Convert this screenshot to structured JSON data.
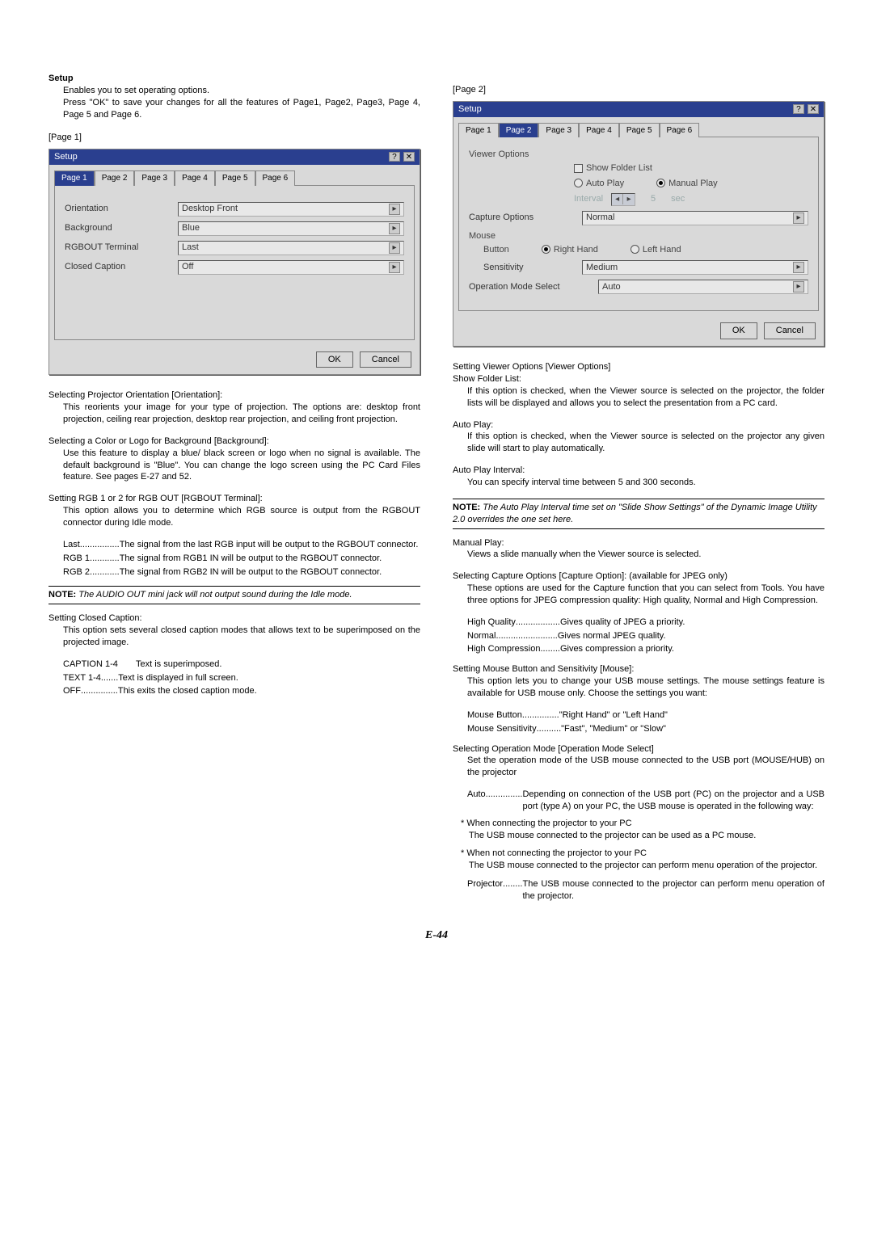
{
  "pageNumber": "E-44",
  "left": {
    "setup": {
      "heading": "Setup",
      "l1": "Enables you to set operating options.",
      "l2": "Press \"OK\" to save your changes for all the features of Page1, Page2, Page3, Page 4, Page 5 and Page 6."
    },
    "page1Label": "[Page 1]",
    "dialog1": {
      "title": "Setup",
      "help": "?",
      "close": "✕",
      "tabs": [
        "Page 1",
        "Page 2",
        "Page 3",
        "Page 4",
        "Page 5",
        "Page 6"
      ],
      "rows": {
        "orientation": {
          "label": "Orientation",
          "value": "Desktop Front"
        },
        "background": {
          "label": "Background",
          "value": "Blue"
        },
        "rgbout": {
          "label": "RGBOUT Terminal",
          "value": "Last"
        },
        "cc": {
          "label": "Closed Caption",
          "value": "Off"
        }
      },
      "ok": "OK",
      "cancel": "Cancel"
    },
    "orient": {
      "h": "Selecting Projector Orientation [Orientation]:",
      "p": "This reorients your image for your type of projection. The options are: desktop front projection, ceiling rear projection, desktop rear projection, and ceiling front projection."
    },
    "bg": {
      "h": "Selecting a Color or Logo for Background [Background]:",
      "p": "Use this feature to display a blue/ black screen or logo when no signal is available. The default background is \"Blue\". You can change the logo screen using the PC Card Files feature. See pages E-27 and 52."
    },
    "rgb": {
      "h": "Setting RGB 1 or 2 for RGB OUT [RGBOUT Terminal]:",
      "p": "This option allows you to determine which RGB source is output from the RGBOUT connector during Idle mode.",
      "last": {
        "t": "Last",
        "d": "The signal from the last RGB input will be output to the RGBOUT connector.",
        "dots": " ................ "
      },
      "r1": {
        "t": "RGB 1",
        "d": "The signal from RGB1 IN will be output to the RGBOUT connector.",
        "dots": " ............ "
      },
      "r2": {
        "t": "RGB 2",
        "d": "The signal from RGB2 IN will be output to the RGBOUT connector.",
        "dots": " ............ "
      }
    },
    "note1": {
      "nb": "NOTE:",
      "t": " The AUDIO OUT mini jack will not output sound during the Idle mode."
    },
    "cc": {
      "h": "Setting Closed Caption:",
      "p": "This option sets several closed caption modes that allows text to be superimposed on the projected image.",
      "c1": {
        "t": "CAPTION 1-4",
        "d": "Text is superimposed."
      },
      "c2": {
        "t": "TEXT 1-4",
        "d": "Text is displayed in full screen.",
        "dots": " ....... "
      },
      "c3": {
        "t": "OFF",
        "d": "This exits the closed caption mode.",
        "dots": " ............... "
      }
    }
  },
  "right": {
    "page2Label": "[Page 2]",
    "dialog2": {
      "title": "Setup",
      "help": "?",
      "close": "✕",
      "tabs": [
        "Page 1",
        "Page 2",
        "Page 3",
        "Page 4",
        "Page 5",
        "Page 6"
      ],
      "viewer": {
        "h": "Viewer Options",
        "showFolder": "Show Folder List",
        "autoPlay": "Auto Play",
        "manualPlay": "Manual Play",
        "intervalLabel": "Interval",
        "intervalUnit": "sec",
        "intervalVal": "5"
      },
      "capture": {
        "label": "Capture Options",
        "value": "Normal"
      },
      "mouse": {
        "h": "Mouse",
        "button": "Button",
        "right": "Right Hand",
        "left": "Left Hand",
        "sens": "Sensitivity",
        "sensVal": "Medium"
      },
      "opmode": {
        "label": "Operation Mode Select",
        "value": "Auto"
      },
      "ok": "OK",
      "cancel": "Cancel"
    },
    "vopts": {
      "h": "Setting Viewer Options [Viewer Options]",
      "sfl": {
        "h": "Show Folder List:",
        "p": "If this option is checked, when the Viewer source is selected on the projector, the folder lists will be displayed and allows you to select the presentation from a PC card."
      },
      "ap": {
        "h": "Auto Play:",
        "p": "If this option is checked, when the Viewer source is selected on the projector any given slide will start to play automatically."
      },
      "api": {
        "h": "Auto Play Interval:",
        "p": "You can specify interval time between 5 and 300 seconds."
      },
      "note": {
        "nb": "NOTE:",
        "t": " The Auto Play Interval time set on \"Slide Show Settings\" of the Dynamic Image Utility 2.0 overrides the one set here."
      },
      "mp": {
        "h": "Manual Play:",
        "p": "Views a slide manually when the Viewer source is selected."
      }
    },
    "cap": {
      "h": "Selecting Capture Options [Capture Option]: (available for JPEG only)",
      "p": "These options are used for the Capture function that you can select from Tools. You have three options for JPEG compression quality: High quality, Normal and High Compression.",
      "hq": {
        "t": "High Quality",
        "d": "Gives quality of JPEG a priority.",
        "dots": " .................. "
      },
      "nm": {
        "t": "Normal",
        "d": "Gives normal JPEG quality.",
        "dots": " ......................... "
      },
      "hc": {
        "t": "High Compression",
        "d": "Gives compression a priority.",
        "dots": " ........ "
      }
    },
    "mouse": {
      "h": "Setting Mouse Button and Sensitivity [Mouse]:",
      "p": "This option lets you to change your USB mouse settings. The mouse settings feature is available for USB mouse only. Choose the settings you want:",
      "mb": {
        "t": "Mouse Button",
        "d": "\"Right Hand\" or \"Left Hand\"",
        "dots": " ............... "
      },
      "ms": {
        "t": "Mouse Sensitivity",
        "d": "\"Fast\", \"Medium\" or \"Slow\"",
        "dots": " .......... "
      }
    },
    "op": {
      "h": "Selecting Operation Mode [Operation Mode Select]",
      "p": "Set the operation mode of the USB mouse connected to the USB port (MOUSE/HUB) on the projector",
      "auto": {
        "t": "Auto",
        "dots": " ............... ",
        "d": "Depending on connection of the USB port (PC) on the projector and a USB port (type A) on your PC, the USB mouse is operated in the following way:"
      },
      "b1h": "When connecting the projector to your PC",
      "b1p": "The USB mouse connected to the projector can be used as a PC mouse.",
      "b2h": "When not connecting the projector to your PC",
      "b2p": "The USB mouse connected to the projector can perform menu operation of the projector.",
      "proj": {
        "t": "Projector",
        "dots": " ........ ",
        "d": "The USB mouse connected to the projector can perform menu operation of the projector."
      }
    }
  }
}
